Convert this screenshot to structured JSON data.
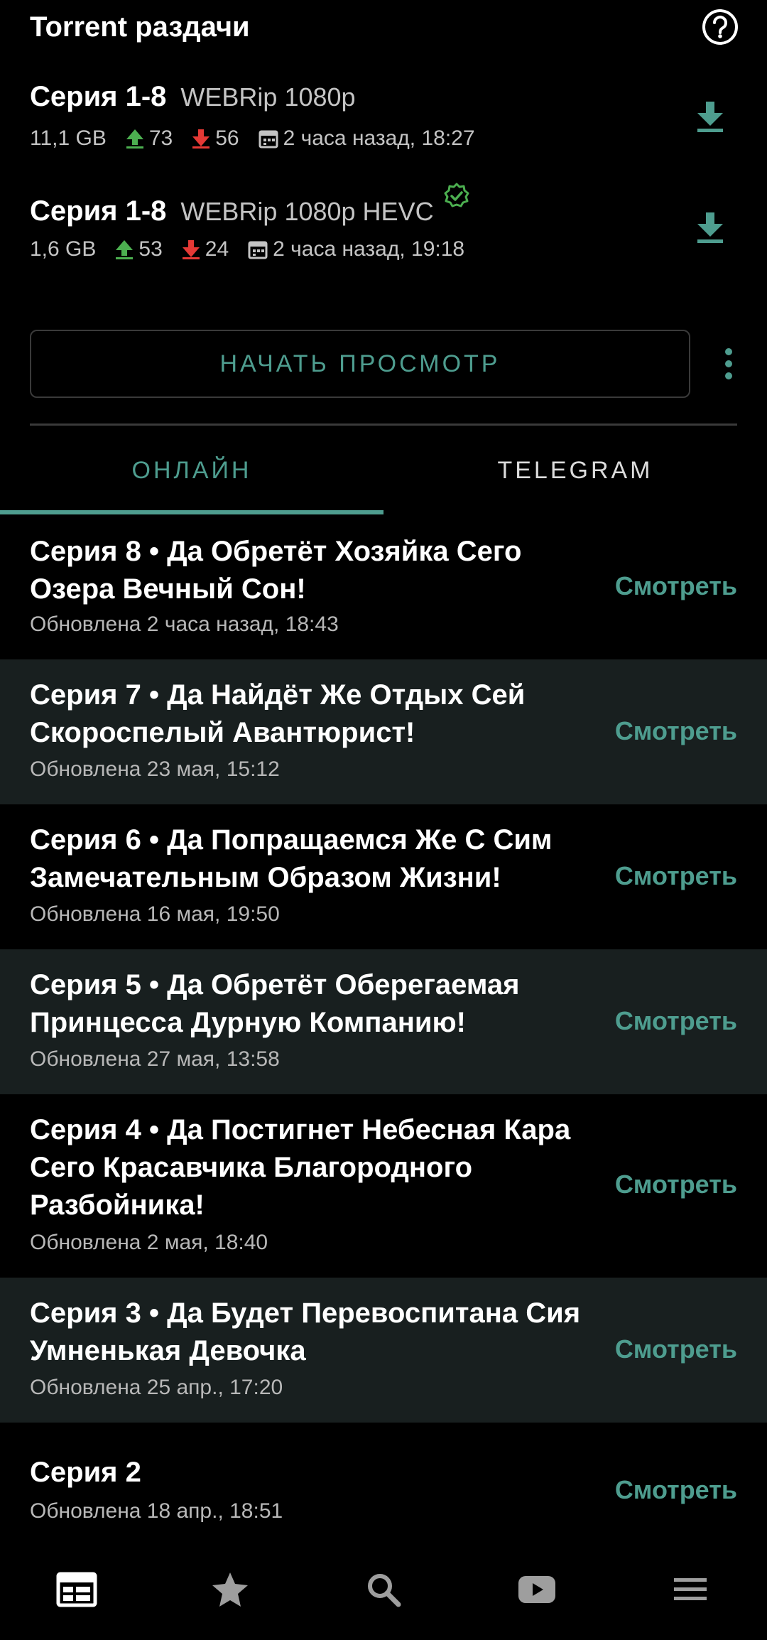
{
  "header": {
    "title": "Torrent раздачи"
  },
  "torrents": [
    {
      "title": "Серия 1-8",
      "quality": "WEBRip 1080p",
      "size": "11,1 GB",
      "seeders": "73",
      "leechers": "56",
      "date": "2 часа назад, 18:27",
      "verified": false
    },
    {
      "title": "Серия 1-8",
      "quality": "WEBRip 1080p HEVC",
      "size": "1,6 GB",
      "seeders": "53",
      "leechers": "24",
      "date": "2 часа назад, 19:18",
      "verified": true
    }
  ],
  "start_button": "НАЧАТЬ ПРОСМОТР",
  "tabs": [
    {
      "label": "ОНЛАЙН",
      "active": true
    },
    {
      "label": "TELEGRAM",
      "active": false
    }
  ],
  "episodes": [
    {
      "title": "Серия 8 • Да Обретёт Хозяйка Сего Озера Вечный Сон!",
      "updated": "Обновлена 2 часа назад, 18:43",
      "action": "Смотреть"
    },
    {
      "title": "Серия 7 • Да Найдёт Же Отдых Сей Скороспелый Авантюрист!",
      "updated": "Обновлена 23 мая, 15:12",
      "action": "Смотреть"
    },
    {
      "title": "Серия 6 • Да Попращаемся Же С Сим Замечательным Образом Жизни!",
      "updated": "Обновлена 16 мая, 19:50",
      "action": "Смотреть"
    },
    {
      "title": "Серия 5 • Да Обретёт Оберегаемая Принцесса Дурную Компанию!",
      "updated": "Обновлена 27 мая, 13:58",
      "action": "Смотреть"
    },
    {
      "title": "Серия 4 • Да Постигнет Небесная Кара Сего Красавчика Благородного Разбойника!",
      "updated": "Обновлена 2 мая, 18:40",
      "action": "Смотреть"
    },
    {
      "title": "Серия 3 • Да Будет Перевоспитана Сия Умненькая Девочка",
      "updated": "Обновлена 25 апр., 17:20",
      "action": "Смотреть"
    },
    {
      "title": "Серия 2",
      "updated": "Обновлена 18 апр., 18:51",
      "action": "Смотреть"
    }
  ],
  "bottom_nav": [
    {
      "icon": "releases-icon",
      "active": true
    },
    {
      "icon": "star-icon",
      "active": false
    },
    {
      "icon": "search-icon",
      "active": false
    },
    {
      "icon": "youtube-icon",
      "active": false
    },
    {
      "icon": "menu-icon",
      "active": false
    }
  ],
  "colors": {
    "accent": "#4e9d8f",
    "seed_up": "#4caf50",
    "leech_down": "#e53935",
    "alt_row": "#181f1f"
  }
}
